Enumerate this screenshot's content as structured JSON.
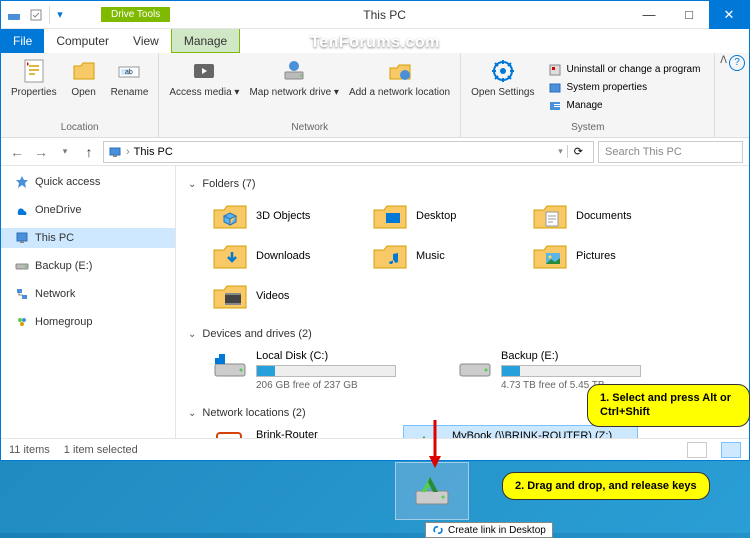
{
  "window": {
    "title": "This PC",
    "contextual_tab": "Drive Tools"
  },
  "win_buttons": {
    "min": "—",
    "max": "□",
    "close": "✕"
  },
  "ribbon_tabs": {
    "file": "File",
    "computer": "Computer",
    "view": "View",
    "manage": "Manage"
  },
  "ribbon": {
    "location": {
      "properties": "Properties",
      "open": "Open",
      "rename": "Rename",
      "label": "Location"
    },
    "network": {
      "access_media": "Access media ▾",
      "map_drive": "Map network drive ▾",
      "add_location": "Add a network location",
      "label": "Network"
    },
    "system": {
      "open_settings": "Open Settings",
      "uninstall": "Uninstall or change a program",
      "sys_props": "System properties",
      "manage": "Manage",
      "label": "System"
    }
  },
  "address": {
    "path": "This PC",
    "search_placeholder": "Search This PC"
  },
  "sidebar": {
    "quick_access": "Quick access",
    "onedrive": "OneDrive",
    "this_pc": "This PC",
    "backup": "Backup (E:)",
    "network": "Network",
    "homegroup": "Homegroup"
  },
  "sections": {
    "folders": "Folders (7)",
    "drives": "Devices and drives (2)",
    "netloc": "Network locations (2)"
  },
  "folders": {
    "objects3d": "3D Objects",
    "desktop": "Desktop",
    "documents": "Documents",
    "downloads": "Downloads",
    "music": "Music",
    "pictures": "Pictures",
    "videos": "Videos"
  },
  "drives": {
    "c": {
      "name": "Local Disk (C:)",
      "sub": "206 GB free of 237 GB",
      "pct": 13
    },
    "e": {
      "name": "Backup (E:)",
      "sub": "4.73 TB free of 5.45 TB",
      "pct": 13
    }
  },
  "netloc": {
    "brink": "Brink-Router",
    "mybook_name": "MyBook (\\\\BRINK-ROUTER) (Z:)"
  },
  "status": {
    "items": "11 items",
    "selected": "1 item selected"
  },
  "callouts": {
    "c1": "1. Select and press Alt or Ctrl+Shift",
    "c2": "2. Drag and drop, and release keys"
  },
  "tooltip": "Create link in Desktop",
  "watermark": "TenForums.com"
}
